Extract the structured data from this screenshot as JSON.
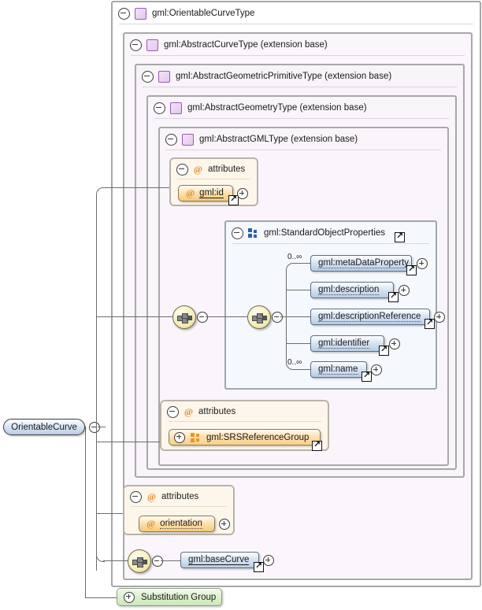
{
  "diagram": {
    "title": "OrientableCurve XML Schema diagram",
    "root_element": {
      "label": "OrientableCurve",
      "kind": "element"
    },
    "containers": [
      {
        "id": "t0",
        "label": "gml:OrientableCurveType",
        "icon": "type-icon",
        "toggle": "minus"
      },
      {
        "id": "t1",
        "label": "gml:AbstractCurveType (extension base)",
        "icon": "type-icon",
        "toggle": "minus"
      },
      {
        "id": "t2",
        "label": "gml:AbstractGeometricPrimitiveType (extension base)",
        "icon": "type-icon",
        "toggle": "minus"
      },
      {
        "id": "t3",
        "label": "gml:AbstractGeometryType (extension base)",
        "icon": "type-icon",
        "toggle": "minus"
      },
      {
        "id": "t4",
        "label": "gml:AbstractGMLType (extension base)",
        "icon": "type-icon",
        "toggle": "minus"
      }
    ],
    "attribute_panels": [
      {
        "id": "a1",
        "label": "attributes",
        "icon": "at-icon",
        "toggle": "minus"
      },
      {
        "id": "a2",
        "label": "attributes",
        "icon": "at-icon",
        "toggle": "minus"
      },
      {
        "id": "a3",
        "label": "attributes",
        "icon": "at-icon",
        "toggle": "minus"
      }
    ],
    "group_panel": {
      "label": "gml:StandardObjectProperties",
      "icon": "group-icon",
      "toggle": "minus",
      "link": "link-arrow"
    },
    "attributes": [
      {
        "id": "gmlid",
        "label": "gml:id",
        "at": "@",
        "use": "required",
        "expand": "plus",
        "link": "link-arrow"
      },
      {
        "id": "orientation",
        "label": "orientation",
        "at": "@",
        "use": "optional",
        "expand": "plus",
        "link": null
      }
    ],
    "attribute_groups": [
      {
        "id": "srs",
        "label": "gml:SRSReferenceGroup",
        "icon": "group-icon",
        "toggle": "plus",
        "link": "link-arrow"
      }
    ],
    "elements": [
      {
        "id": "metaDataProperty",
        "label": "gml:metaDataProperty",
        "cardinality": "0..∞",
        "use": "optional",
        "expand": "plus",
        "link": "link-arrow"
      },
      {
        "id": "description",
        "label": "gml:description",
        "cardinality": "",
        "use": "optional",
        "expand": "plus",
        "link": "link-arrow"
      },
      {
        "id": "descriptionReference",
        "label": "gml:descriptionReference",
        "cardinality": "",
        "use": "optional",
        "expand": "plus",
        "link": "link-arrow"
      },
      {
        "id": "identifier",
        "label": "gml:identifier",
        "cardinality": "",
        "use": "optional",
        "expand": "plus",
        "link": "link-arrow"
      },
      {
        "id": "name",
        "label": "gml:name",
        "cardinality": "0..∞",
        "use": "optional",
        "expand": "plus",
        "link": "link-arrow"
      },
      {
        "id": "baseCurve",
        "label": "gml:baseCurve",
        "cardinality": "",
        "use": "required",
        "expand": "plus",
        "link": "link-arrow"
      }
    ],
    "compositors": [
      {
        "id": "seq-outer",
        "kind": "sequence",
        "toggle": "minus"
      },
      {
        "id": "seq-inner",
        "kind": "sequence",
        "toggle": "minus"
      },
      {
        "id": "seq-base",
        "kind": "sequence",
        "toggle": "minus"
      }
    ],
    "substitution_group": {
      "label": "Substitution Group",
      "toggle": "plus"
    },
    "colors": {
      "element_fill": "#b7cbe6",
      "attribute_fill": "#f7c877",
      "type_icon": "#9b59b6",
      "group_icon": "#2c5fa8",
      "group_icon_orange": "#e8962a",
      "substitution_fill": "#cde8b8",
      "compositor_fill": "#f6eebb",
      "container_border": "#a8a8a8",
      "connector": "#6d6d6d"
    }
  }
}
